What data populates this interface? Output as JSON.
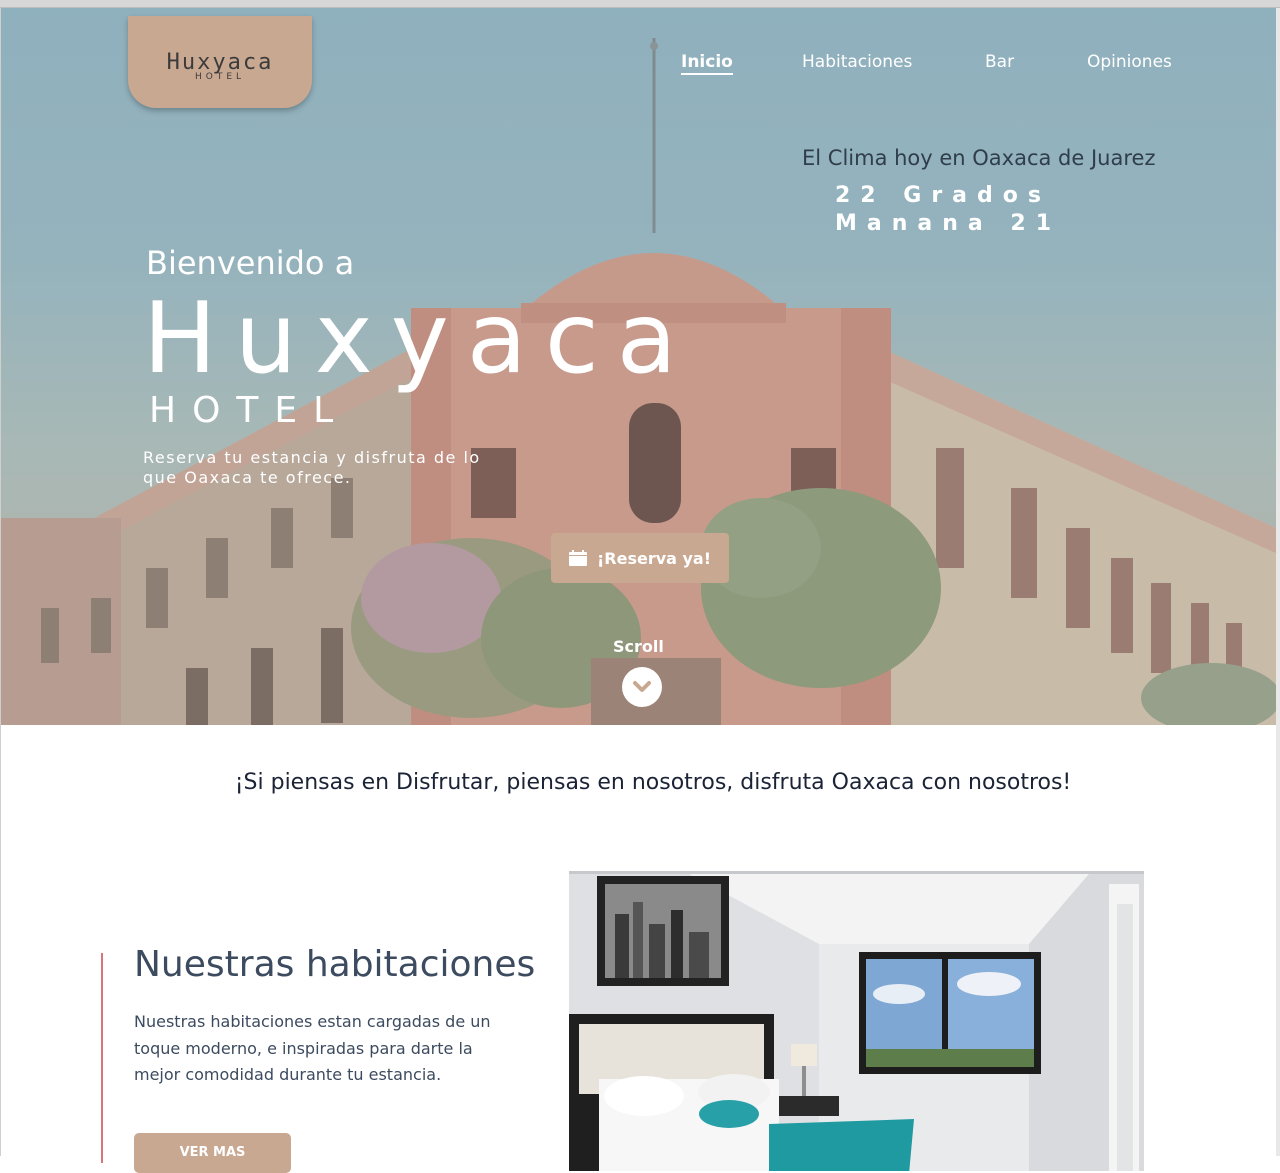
{
  "header": {
    "logo_text": "Huxyaca",
    "logo_subtext": "HOTEL",
    "nav": [
      {
        "label": "Inicio",
        "active": true
      },
      {
        "label": "Habitaciones",
        "active": false
      },
      {
        "label": "Bar",
        "active": false
      },
      {
        "label": "Opiniones",
        "active": false
      }
    ]
  },
  "weather": {
    "title": "El Clima hoy en Oaxaca de Juarez",
    "today": "22 Grados",
    "tomorrow": "Manana 21"
  },
  "hero": {
    "welcome": "Bienvenido a",
    "brand": "Huxyaca",
    "brand_sub": "HOTEL",
    "tagline": "Reserva tu estancia y disfruta de lo que Oaxaca te ofrece.",
    "reserve_label": "¡Reserva ya!",
    "reserve_icon": "calendar-icon",
    "scroll_label": "Scroll",
    "scroll_icon": "chevron-down-icon"
  },
  "slogan": "¡Si piensas en Disfrutar, piensas en nosotros, disfruta Oaxaca con nosotros!",
  "rooms": {
    "title": "Nuestras habitaciones",
    "text": "Nuestras habitaciones estan cargadas  de un toque moderno, e inspiradas para darte la mejor comodidad durante tu estancia.",
    "button_label": "VER MAS"
  },
  "colors": {
    "accent": "#c9a891",
    "accent_line": "#d9747a",
    "heading": "#3c4b5f",
    "slogan": "#1b2336"
  }
}
